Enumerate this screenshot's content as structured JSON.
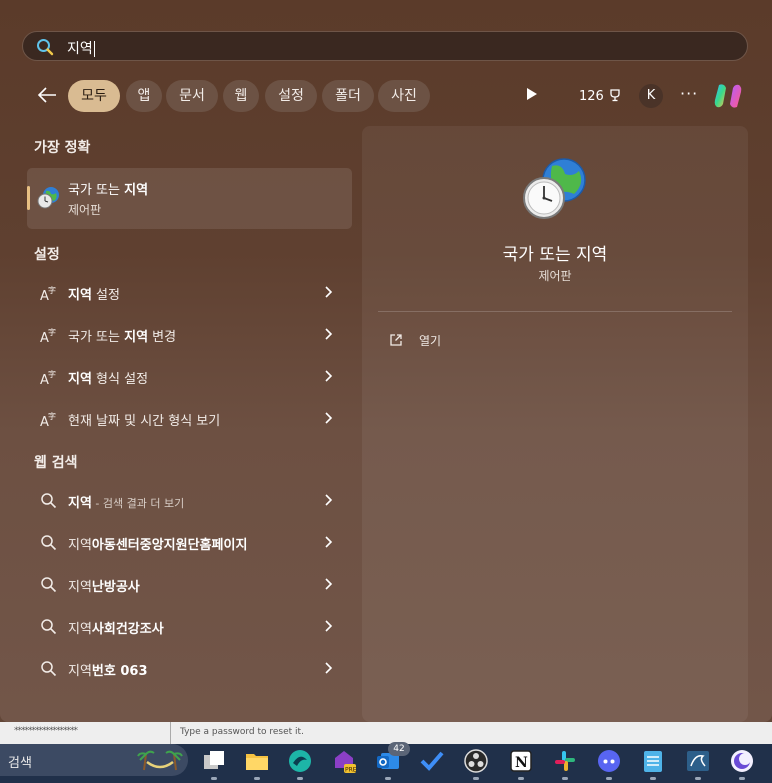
{
  "search": {
    "query": "지역"
  },
  "filters": {
    "items": [
      "모두",
      "앱",
      "문서",
      "웹",
      "설정",
      "폴더",
      "사진"
    ],
    "active": "모두"
  },
  "toolbar": {
    "points": "126",
    "avatar_letter": "K",
    "more_label": "···"
  },
  "best_match": {
    "heading": "가장 정확",
    "title_prefix": "국가 또는 ",
    "title_bold": "지역",
    "subtitle": "제어판"
  },
  "settings": {
    "heading": "설정",
    "items": [
      {
        "bold": "지역",
        "rest": " 설정"
      },
      {
        "pre": "국가 또는 ",
        "bold": "지역",
        "rest": " 변경"
      },
      {
        "bold": "지역",
        "rest": " 형식 설정"
      },
      {
        "rest": "현재 날짜 및 시간 형식 보기"
      }
    ]
  },
  "web": {
    "heading": "웹 검색",
    "items": [
      {
        "bold": "지역",
        "sub": " - 검색 결과 더 보기"
      },
      {
        "pre": "지역",
        "bold": "아동센터중앙지원단홈페이지"
      },
      {
        "pre": "지역",
        "bold": "난방공사"
      },
      {
        "pre": "지역",
        "bold": "사회건강조사"
      },
      {
        "pre": "지역",
        "bold": "번호 063"
      }
    ]
  },
  "preview": {
    "title": "국가 또는 지역",
    "subtitle": "제어판",
    "open_label": "열기"
  },
  "background_window": {
    "stars": "******************",
    "hint": "Type a password to reset it."
  },
  "taskbar": {
    "search_label": "검색",
    "badge_count": "42"
  },
  "colors": {
    "active_chip": "#d9bb92",
    "accent_bar": "#e8c083",
    "taskbar": "#20304a"
  }
}
